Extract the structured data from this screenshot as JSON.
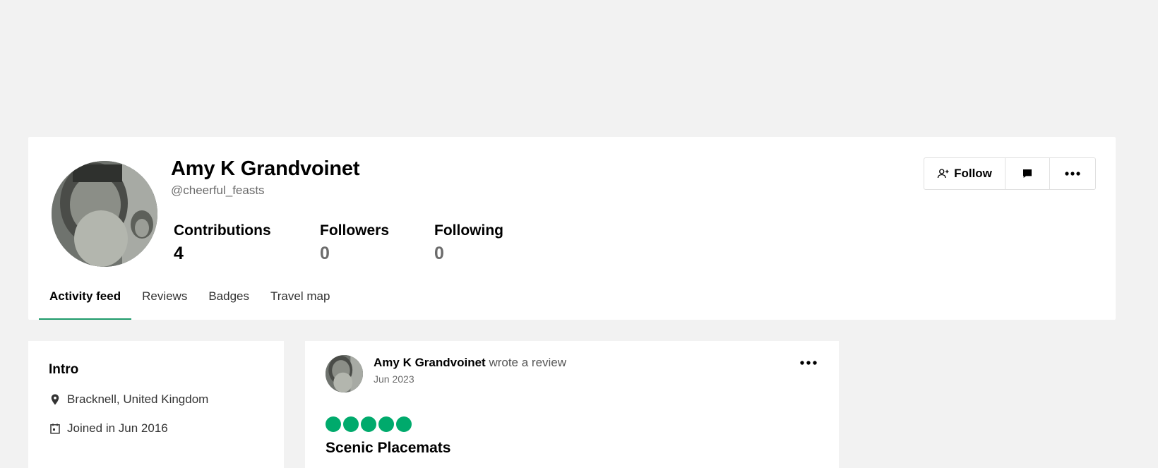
{
  "profile": {
    "name": "Amy K Grandvoinet",
    "handle": "@cheerful_feasts",
    "stats": {
      "contributions_label": "Contributions",
      "contributions_value": "4",
      "followers_label": "Followers",
      "followers_value": "0",
      "following_label": "Following",
      "following_value": "0"
    },
    "actions": {
      "follow_label": "Follow",
      "follow_icon": "add-user-icon",
      "message_icon": "chat-bubble-icon",
      "more_icon": "more-dots-icon"
    }
  },
  "tabs": [
    {
      "label": "Activity feed",
      "active": true
    },
    {
      "label": "Reviews",
      "active": false
    },
    {
      "label": "Badges",
      "active": false
    },
    {
      "label": "Travel map",
      "active": false
    }
  ],
  "intro": {
    "title": "Intro",
    "location": "Bracknell, United Kingdom",
    "joined": "Joined in Jun 2016"
  },
  "feed_item": {
    "author": "Amy K Grandvoinet",
    "action": "wrote a review",
    "date": "Jun 2023",
    "rating": 5,
    "review_title": "Scenic Placemats"
  },
  "colors": {
    "accent": "#00aa6c",
    "tab_underline": "#1f9b6b",
    "background": "#f2f2f2",
    "muted_text": "#6b6b6b"
  }
}
